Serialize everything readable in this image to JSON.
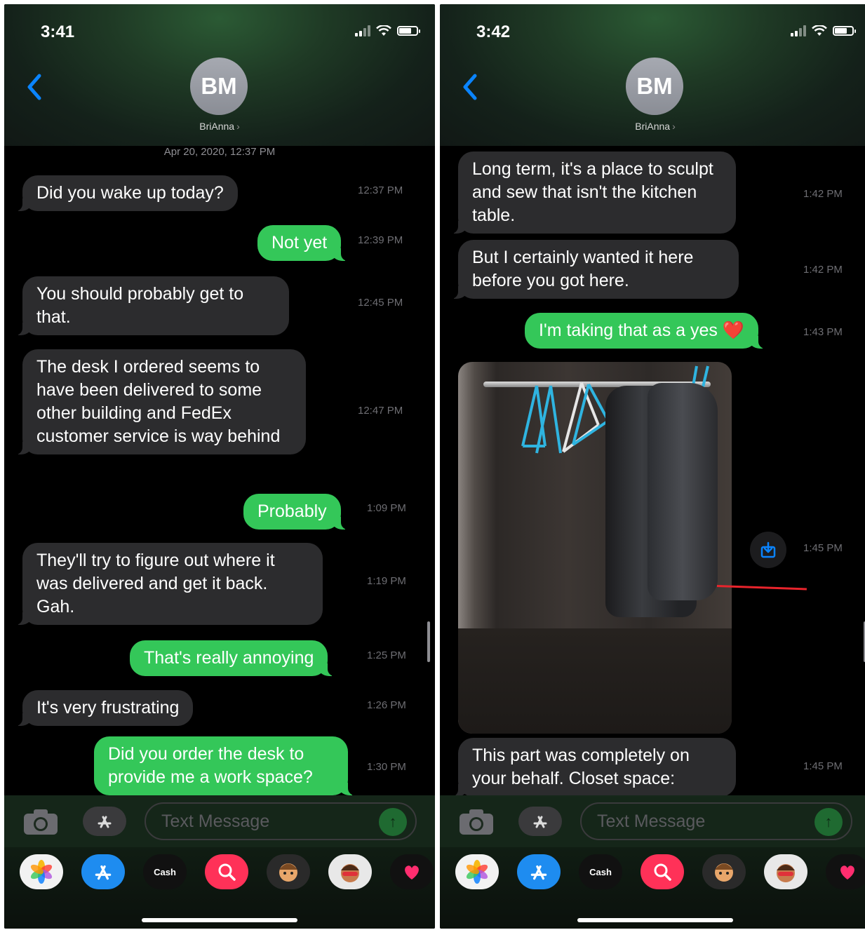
{
  "left_screen": {
    "status_time": "3:41",
    "contact_initials": "BM",
    "contact_name": "BriAnna",
    "contact_chevron": "›",
    "date_header": "Apr 20, 2020, 12:37 PM",
    "messages": [
      {
        "direction": "received",
        "text": "Did you wake up today?",
        "time": "12:37 PM"
      },
      {
        "direction": "sent",
        "text": "Not yet",
        "time": "12:39 PM"
      },
      {
        "direction": "received",
        "text": "You should probably get to that.",
        "time": "12:45 PM"
      },
      {
        "direction": "received",
        "text": "The desk I ordered seems to have been delivered to some other building and FedEx customer service is way behind",
        "time": "12:47 PM"
      },
      {
        "direction": "sent",
        "text": "Probably",
        "time": "1:09 PM"
      },
      {
        "direction": "received",
        "text": "They'll try to figure out where it was delivered and get it back. Gah.",
        "time": "1:19 PM"
      },
      {
        "direction": "sent",
        "text": "That's really annoying",
        "time": "1:25 PM"
      },
      {
        "direction": "received",
        "text": "It's very frustrating",
        "time": "1:26 PM"
      },
      {
        "direction": "sent",
        "text": "Did you order the desk to provide me a work space?",
        "time": "1:30 PM"
      }
    ],
    "input_placeholder": "Text Message"
  },
  "right_screen": {
    "status_time": "3:42",
    "contact_initials": "BM",
    "contact_name": "BriAnna",
    "contact_chevron": "›",
    "messages": [
      {
        "direction": "received",
        "text": "Long term, it's a place to sculpt and sew that isn't the kitchen table.",
        "time": "1:42 PM"
      },
      {
        "direction": "received",
        "text": "But I certainly wanted it here before you got here.",
        "time": "1:42 PM"
      },
      {
        "direction": "sent",
        "text": "I'm taking that as a yes ❤️",
        "time": "1:43 PM"
      },
      {
        "direction": "received",
        "type": "photo",
        "time": "1:45 PM"
      },
      {
        "direction": "received",
        "text": "This part was completely on your behalf. Closet space:",
        "time": "1:45 PM"
      }
    ],
    "input_placeholder": "Text Message"
  },
  "input_bar": {
    "camera_icon": "camera-icon",
    "apps_icon": "app-store-icon",
    "send_icon": "arrow-up-icon"
  },
  "app_drawer": [
    {
      "name": "photos-icon"
    },
    {
      "name": "app-store-icon"
    },
    {
      "name": "apple-cash-icon",
      "label": "Cash"
    },
    {
      "name": "image-search-icon"
    },
    {
      "name": "memoji-icon"
    },
    {
      "name": "memoji-stickers-icon"
    },
    {
      "name": "digital-touch-icon"
    }
  ],
  "colors": {
    "sent_bubble": "#34c759",
    "received_bubble": "#2c2c2e",
    "link_blue": "#0a84ff",
    "annotation_red": "#e8242c"
  }
}
